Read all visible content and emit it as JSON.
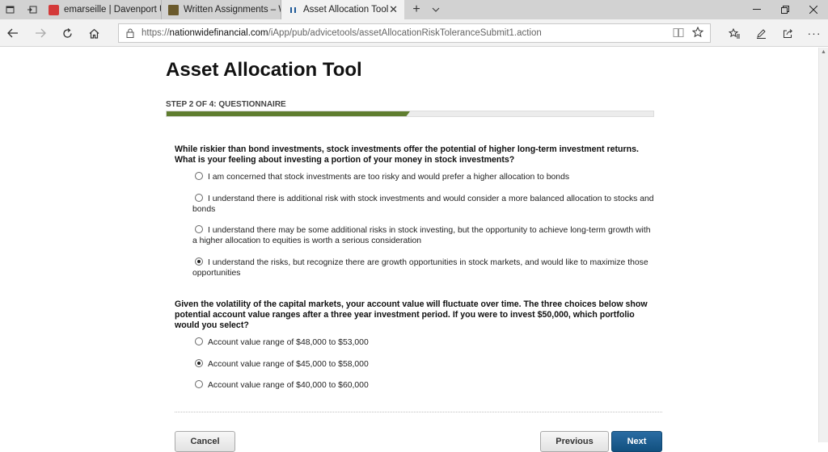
{
  "browser": {
    "tabs": [
      {
        "title": "emarseille | Davenport Univ",
        "fav_color": "#d43a3a"
      },
      {
        "title": "Written Assignments – Win",
        "fav_color": "#6b5a2c"
      },
      {
        "title": "Asset Allocation Tool",
        "fav_color": "#1f5a98",
        "active": true
      }
    ],
    "new_tab_glyph": "+",
    "url_prefix": "https://",
    "url_host": "nationwidefinancial.com",
    "url_path": "/iApp/pub/advicetools/assetAllocationRiskToleranceSubmit1.action"
  },
  "page": {
    "title": "Asset Allocation Tool",
    "step_label": "STEP 2 OF 4: QUESTIONNAIRE",
    "progress_fraction": 0.5,
    "question1": {
      "text": "While riskier than bond investments, stock investments offer the potential of higher long-term investment returns. What is your feeling about investing a portion of your money in stock investments?",
      "options": [
        {
          "label": "I am concerned that stock investments are too risky and would prefer a higher allocation to bonds",
          "selected": false
        },
        {
          "label": "I understand there is additional risk with stock investments and would consider a more balanced allocation to stocks and bonds",
          "selected": false
        },
        {
          "label": "I understand there may be some additional risks in stock investing, but the opportunity to achieve long-term growth with a higher allocation to equities is worth a serious consideration",
          "selected": false
        },
        {
          "label": "I understand the risks, but recognize there are growth opportunities in stock markets, and would like to maximize those opportunities",
          "selected": true
        }
      ]
    },
    "question2": {
      "text": "Given the volatility of the capital markets, your account value will fluctuate over time. The three choices below show potential account value ranges after a three year investment period. If you were to invest $50,000, which portfolio would you select?",
      "options": [
        {
          "label": "Account value range of $48,000 to $53,000",
          "selected": false
        },
        {
          "label": "Account value range of $45,000 to $58,000",
          "selected": true
        },
        {
          "label": "Account value range of $40,000 to $60,000",
          "selected": false
        }
      ]
    },
    "buttons": {
      "cancel": "Cancel",
      "previous": "Previous",
      "next": "Next"
    }
  },
  "colors": {
    "progress": "#5f7d2f",
    "primary_button": "#12507f"
  }
}
